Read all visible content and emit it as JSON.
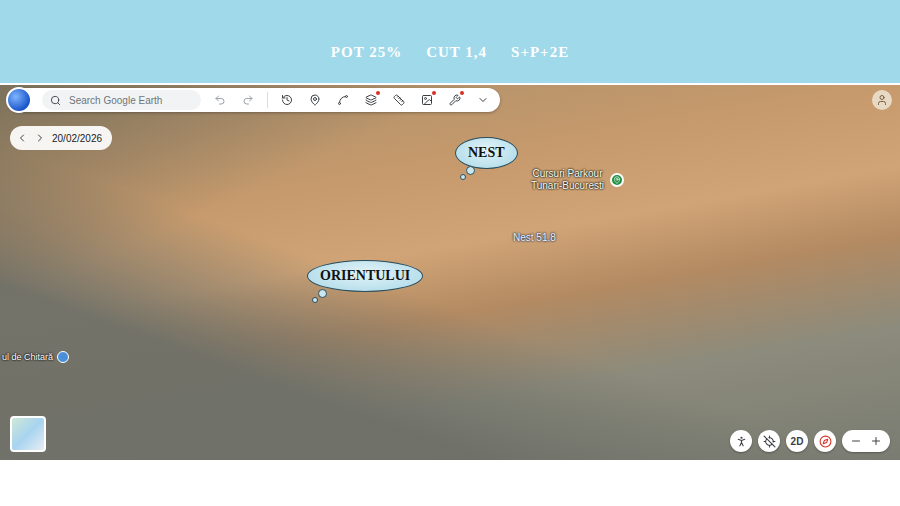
{
  "header": {
    "items": [
      "POT 25%",
      "CUT 1,4",
      "S+P+2E"
    ]
  },
  "toolbar": {
    "search": {
      "placeholder": "Search Google Earth"
    }
  },
  "date_nav": {
    "date": "20/02/2026"
  },
  "map": {
    "labels": [
      {
        "kind": "cloud",
        "lines": [
          "NEST"
        ]
      },
      {
        "kind": "cloud",
        "lines": [
          "ORIENTULUI"
        ]
      },
      {
        "kind": "place",
        "lines": [
          "Cursuri Parkour",
          "Tunari-Bucuresti"
        ]
      },
      {
        "kind": "road",
        "lines": [
          "Nest 51.8"
        ]
      },
      {
        "kind": "poi",
        "lines": [
          "ul de Chitară"
        ]
      }
    ]
  },
  "controls": {
    "view_mode": "2D"
  }
}
